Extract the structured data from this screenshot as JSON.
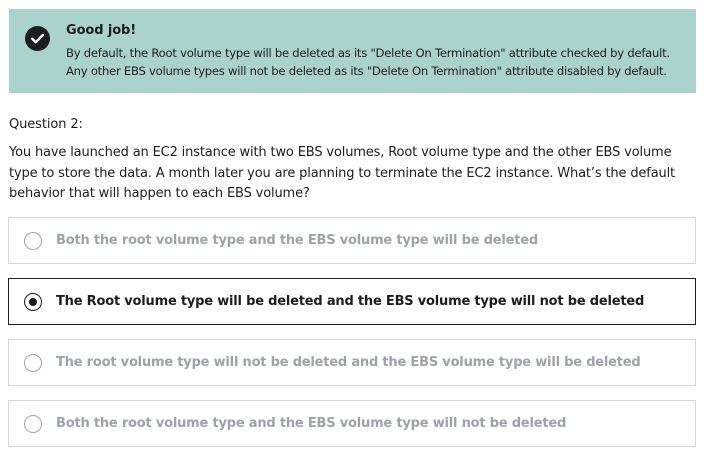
{
  "feedback": {
    "icon": "check-circle-icon",
    "title": "Good job!",
    "line1": "By default, the Root volume type will be deleted as its \"Delete On Termination\" attribute checked by default.",
    "line2": "Any other EBS volume types will not be deleted as its \"Delete On Termination\" attribute disabled by default.",
    "background": "#acd2cc"
  },
  "question": {
    "number": "Question 2:",
    "text": "You have launched an EC2 instance with two EBS volumes, Root volume type and the other EBS volume type to store the data. A month later you are planning to terminate the EC2 instance. What’s the default behavior that will happen to each EBS volume?"
  },
  "options": [
    {
      "label": "Both the root volume type and the EBS volume type will be deleted",
      "selected": false
    },
    {
      "label": "The Root volume type will be deleted and the EBS volume type will not be deleted",
      "selected": true
    },
    {
      "label": "The root volume type will not be deleted and the EBS volume type will be deleted",
      "selected": false
    },
    {
      "label": "Both the root volume type and the EBS volume type will not be deleted",
      "selected": false
    }
  ]
}
